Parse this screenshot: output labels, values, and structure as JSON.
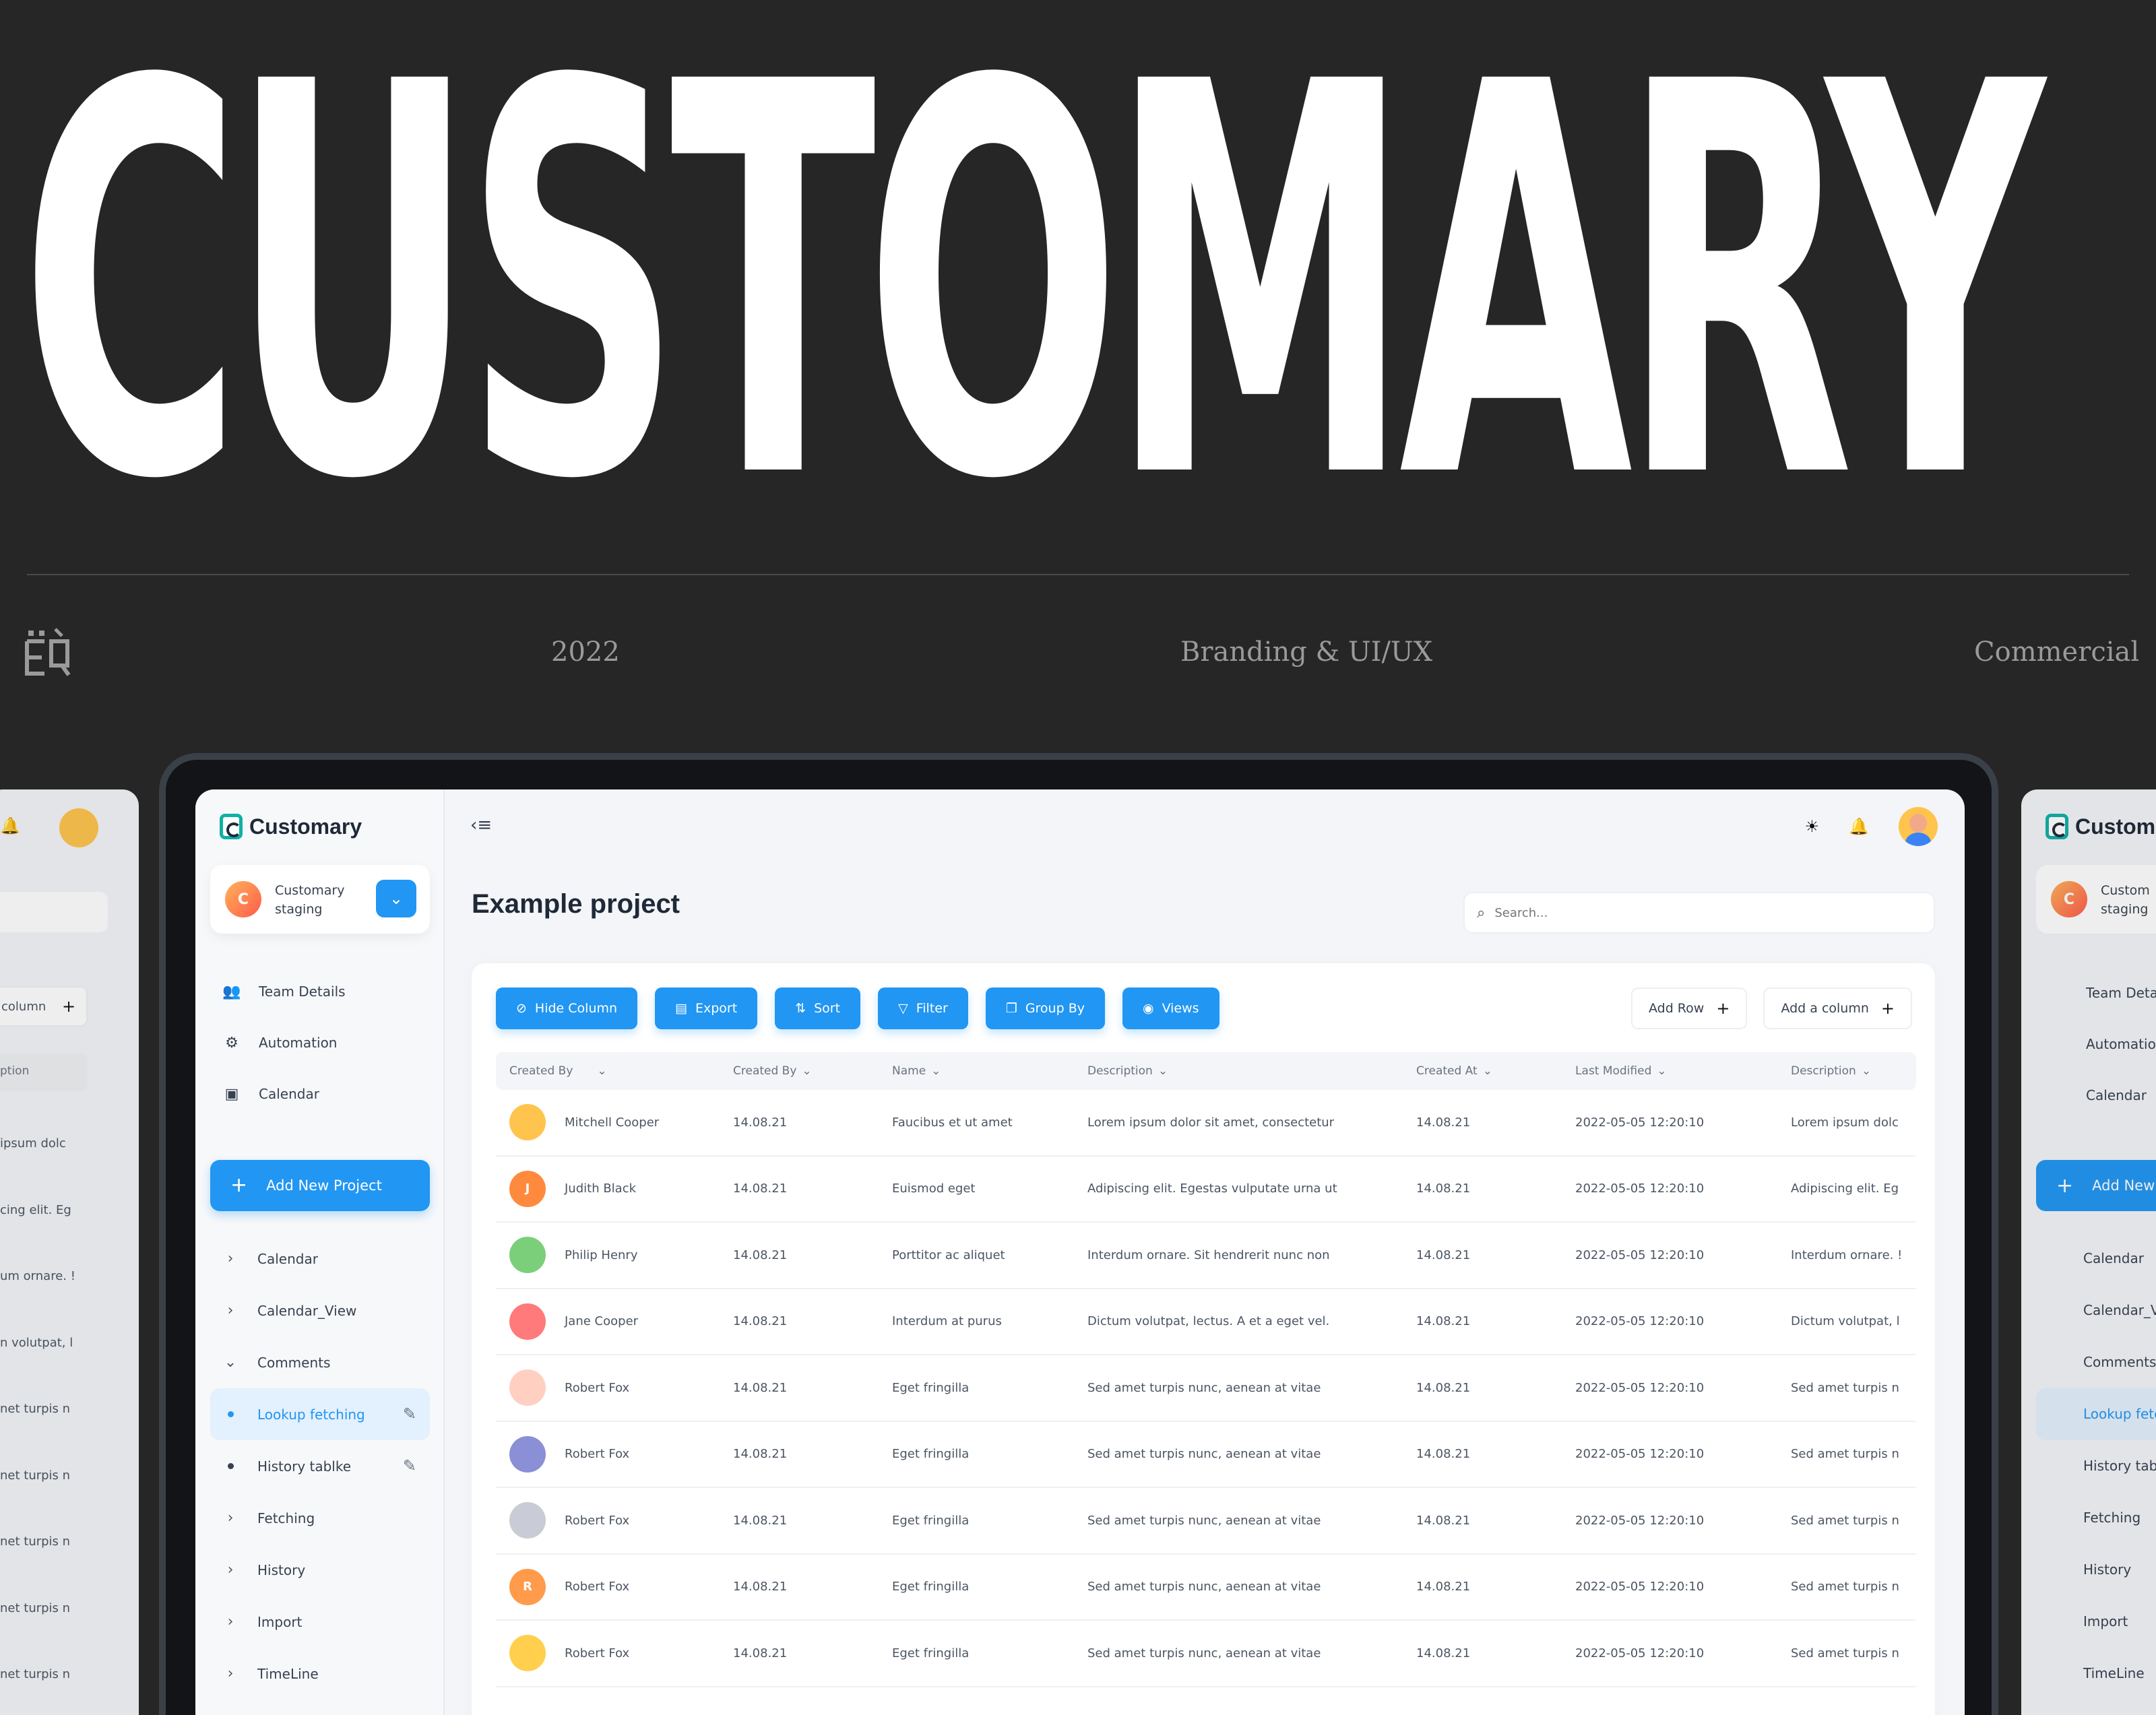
{
  "hero": {
    "title": "CUSTOMARY",
    "year": "2022",
    "category": "Branding & UI/UX",
    "type": "Commercial",
    "logo_text": "ËQ"
  },
  "app": {
    "brand": "Customary",
    "workspace": {
      "initial": "C",
      "name": "Customary staging"
    },
    "nav": [
      {
        "label": "Team Details",
        "icon": "team-icon"
      },
      {
        "label": "Automation",
        "icon": "automation-icon"
      },
      {
        "label": "Calendar",
        "icon": "calendar-icon"
      }
    ],
    "add_project": "Add New Project",
    "tree": [
      {
        "label": "Calendar",
        "kind": "collapsed"
      },
      {
        "label": "Calendar_View",
        "kind": "collapsed"
      },
      {
        "label": "Comments",
        "kind": "expanded"
      },
      {
        "label": "Lookup fetching",
        "kind": "child-active"
      },
      {
        "label": "History tablke",
        "kind": "child"
      },
      {
        "label": "Fetching",
        "kind": "collapsed"
      },
      {
        "label": "History",
        "kind": "collapsed"
      },
      {
        "label": "Import",
        "kind": "collapsed"
      },
      {
        "label": "TimeLine",
        "kind": "collapsed"
      }
    ],
    "page_title": "Example project",
    "search_placeholder": "Search...",
    "toolbar": [
      "Hide Column",
      "Export",
      "Sort",
      "Filter",
      "Group By",
      "Views"
    ],
    "toolbar_right": [
      "Add Row",
      "Add a column"
    ],
    "columns": [
      "Created By",
      "Created By",
      "Name",
      "Description",
      "Created At",
      "Last Modified",
      "Description"
    ],
    "rows": [
      {
        "person": "Mitchell Cooper",
        "date": "14.08.21",
        "name": "Faucibus et ut amet",
        "desc": "Lorem ipsum dolor sit amet, consectetur",
        "created": "14.08.21",
        "modified": "2022-05-05  12:20:10",
        "desc2": "Lorem ipsum dolc",
        "avatar": "#ffc44d",
        "initial": ""
      },
      {
        "person": "Judith Black",
        "date": "14.08.21",
        "name": "Euismod eget",
        "desc": "Adipiscing elit. Egestas vulputate urna ut",
        "created": "14.08.21",
        "modified": "2022-05-05  12:20:10",
        "desc2": "Adipiscing elit. Eg",
        "avatar": "#ff8a3d",
        "initial": "J"
      },
      {
        "person": "Philip Henry",
        "date": "14.08.21",
        "name": "Porttitor ac aliquet",
        "desc": "Interdum ornare. Sit hendrerit nunc non",
        "created": "14.08.21",
        "modified": "2022-05-05  12:20:10",
        "desc2": "Interdum ornare. !",
        "avatar": "#7ccf7a",
        "initial": ""
      },
      {
        "person": "Jane Cooper",
        "date": "14.08.21",
        "name": "Interdum at purus",
        "desc": "Dictum volutpat, lectus. A et a eget vel.",
        "created": "14.08.21",
        "modified": "2022-05-05  12:20:10",
        "desc2": "Dictum volutpat, l",
        "avatar": "#ff7a7a",
        "initial": ""
      },
      {
        "person": "Robert Fox",
        "date": "14.08.21",
        "name": "Eget fringilla",
        "desc": "Sed amet turpis nunc, aenean at vitae",
        "created": "14.08.21",
        "modified": "2022-05-05  12:20:10",
        "desc2": "Sed amet turpis n",
        "avatar": "#ffd0c2",
        "initial": ""
      },
      {
        "person": "Robert Fox",
        "date": "14.08.21",
        "name": "Eget fringilla",
        "desc": "Sed amet turpis nunc, aenean at vitae",
        "created": "14.08.21",
        "modified": "2022-05-05  12:20:10",
        "desc2": "Sed amet turpis n",
        "avatar": "#8b8fd6",
        "initial": ""
      },
      {
        "person": "Robert Fox",
        "date": "14.08.21",
        "name": "Eget fringilla",
        "desc": "Sed amet turpis nunc, aenean at vitae",
        "created": "14.08.21",
        "modified": "2022-05-05  12:20:10",
        "desc2": "Sed amet turpis n",
        "avatar": "#c9cbd6",
        "initial": ""
      },
      {
        "person": "Robert Fox",
        "date": "14.08.21",
        "name": "Eget fringilla",
        "desc": "Sed amet turpis nunc, aenean at vitae",
        "created": "14.08.21",
        "modified": "2022-05-05  12:20:10",
        "desc2": "Sed amet turpis n",
        "avatar": "#ff9b4a",
        "initial": "R"
      },
      {
        "person": "Robert Fox",
        "date": "14.08.21",
        "name": "Eget fringilla",
        "desc": "Sed amet turpis nunc, aenean at vitae",
        "created": "14.08.21",
        "modified": "2022-05-05  12:20:10",
        "desc2": "Sed amet turpis n",
        "avatar": "#ffcf4d",
        "initial": ""
      }
    ]
  },
  "ghost_left": {
    "col_label": "column",
    "head_label": "ption",
    "rows": [
      "ipsum dolc",
      "cing elit. Eg",
      "um ornare. !",
      "n volutpat, l",
      "net turpis n",
      "net turpis n",
      "net turpis n",
      "net turpis n",
      "net turpis n"
    ]
  },
  "ghost_right": {
    "brand": "Custom",
    "ws": "Custom staging",
    "nav": [
      "Team Detai",
      "Automation",
      "Calendar"
    ],
    "add": "Add New P",
    "tree": [
      "Calendar",
      "Calendar_V",
      "Comments",
      "Lookup fetc",
      "History tab",
      "Fetching",
      "History",
      "Import",
      "TimeLine"
    ]
  },
  "colors": {
    "accent": "#2196f3",
    "background": "#262626",
    "brand_teal": "#0fb0a6"
  }
}
